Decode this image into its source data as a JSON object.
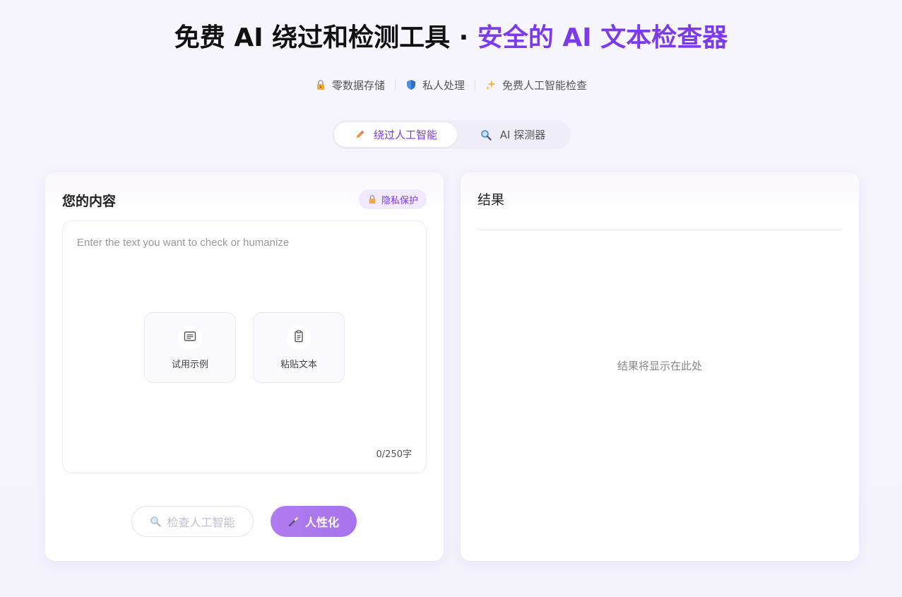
{
  "header": {
    "title_main": "免费 AI 绕过和检测工具",
    "title_sep": " · ",
    "title_accent": "安全的 AI 文本检查器"
  },
  "features": [
    {
      "label": "零数据存储",
      "icon": "lock-icon"
    },
    {
      "label": "私人处理",
      "icon": "shield-icon"
    },
    {
      "label": "免费人工智能检查",
      "icon": "sparkles-icon"
    }
  ],
  "tabs": [
    {
      "label": "绕过人工智能",
      "icon": "pencil-icon",
      "active": true
    },
    {
      "label": "AI 探测器",
      "icon": "magnifier-icon",
      "active": false
    }
  ],
  "input_panel": {
    "title": "您的内容",
    "privacy_badge": "隐私保护",
    "placeholder": "Enter the text you want to check or humanize",
    "value": "",
    "quick_actions": [
      {
        "label": "试用示例",
        "icon": "document-icon"
      },
      {
        "label": "粘贴文本",
        "icon": "clipboard-icon"
      }
    ],
    "counter": "0/250字",
    "check_button": "检查人工智能",
    "humanize_button": "人性化"
  },
  "result_panel": {
    "title": "结果",
    "empty_text": "结果将显示在此处"
  },
  "colors": {
    "accent": "#7c3aed",
    "button_gradient_start": "#b07cef",
    "button_gradient_end": "#a673ec"
  }
}
